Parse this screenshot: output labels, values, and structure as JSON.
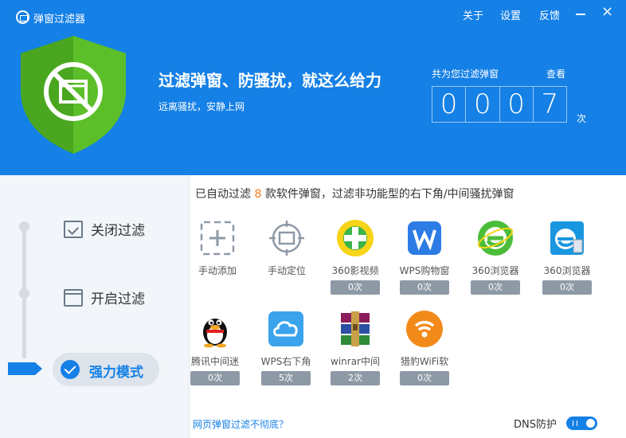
{
  "window": {
    "title": "弹窗过滤器",
    "menu": [
      "关于",
      "设置",
      "反馈"
    ],
    "minimize_label": "—",
    "close_label": "×"
  },
  "header": {
    "headline": "过滤弹窗、防骚扰，就这么给力",
    "subline": "远离骚扰，安静上网",
    "counter_label": "共为您过滤弹窗",
    "counter_link": "查看",
    "counter_digits": [
      "0",
      "0",
      "0",
      "7"
    ],
    "counter_unit": "次"
  },
  "modes": {
    "items": [
      {
        "label": "关闭过滤",
        "icon": "checkbox-icon"
      },
      {
        "label": "开启过滤",
        "icon": "window-icon"
      },
      {
        "label": "强力模式",
        "icon": "check-circle-icon",
        "active": true
      }
    ]
  },
  "summary": {
    "prefix": "已自动过滤 ",
    "count": "8",
    "suffix": " 款软件弹窗，过滤非功能型的右下角/中间骚扰弹窗"
  },
  "actions": [
    {
      "label": "手动添加",
      "icon": "add-icon"
    },
    {
      "label": "手动定位",
      "icon": "target-icon"
    }
  ],
  "apps": [
    {
      "name": "360影视频",
      "count": "0次",
      "icon": "360-video-icon"
    },
    {
      "name": "WPS购物窗",
      "count": "0次",
      "icon": "wps-icon"
    },
    {
      "name": "360浏览器",
      "count": "0次",
      "icon": "360-browser-icon"
    },
    {
      "name": "360浏览器",
      "count": "0次",
      "icon": "360-browser-blue-icon"
    },
    {
      "name": "腾讯中间迷",
      "count": "0次",
      "icon": "qq-penguin-icon"
    },
    {
      "name": "WPS右下角",
      "count": "5次",
      "icon": "wps-cloud-icon"
    },
    {
      "name": "winrar中间",
      "count": "2次",
      "icon": "winrar-icon"
    },
    {
      "name": "猎豹WiFi软",
      "count": "0次",
      "icon": "cheetah-wifi-icon"
    }
  ],
  "footer": {
    "link": "网页弹窗过滤不彻底？",
    "dns_label": "DNS防护",
    "dns_enabled": true
  },
  "colors": {
    "accent": "#1580e6",
    "shield": "#5cbf2a",
    "highlight": "#f47d1e"
  }
}
